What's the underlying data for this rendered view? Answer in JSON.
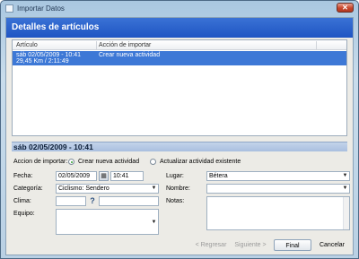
{
  "window": {
    "title": "Importar Datos",
    "close_glyph": "✕"
  },
  "header": {
    "title": "Detalles de artículos"
  },
  "list": {
    "columns": [
      "Artículo",
      "Acción de importar"
    ],
    "rows": [
      {
        "line1": "sáb 02/05/2009 - 10:41",
        "line2": "29,45 Km  /  2:11:49",
        "action": "Crear nueva actividad"
      }
    ]
  },
  "detail": {
    "title": "sáb 02/05/2009 - 10:41",
    "import_action_label": "Accion de importar:",
    "radio_create": "Crear nueva actividad",
    "radio_update": "Actualizar actividad existente",
    "radio_selected": "create",
    "labels": {
      "fecha": "Fecha:",
      "categoria": "Categoría:",
      "clima": "Clima:",
      "equipo": "Equipo:",
      "lugar": "Lugar:",
      "nombre": "Nombre:",
      "notas": "Notas:"
    },
    "values": {
      "date": "02/05/2009",
      "time": "10:41",
      "category": "Ciclismo: Sendero",
      "clima_temp": "",
      "clima_text": "",
      "lugar": "Bétera",
      "nombre": "",
      "notas": ""
    }
  },
  "buttons": {
    "back": "< Regresar",
    "next": "Siguiente >",
    "finish": "Final",
    "cancel": "Cancelar"
  }
}
